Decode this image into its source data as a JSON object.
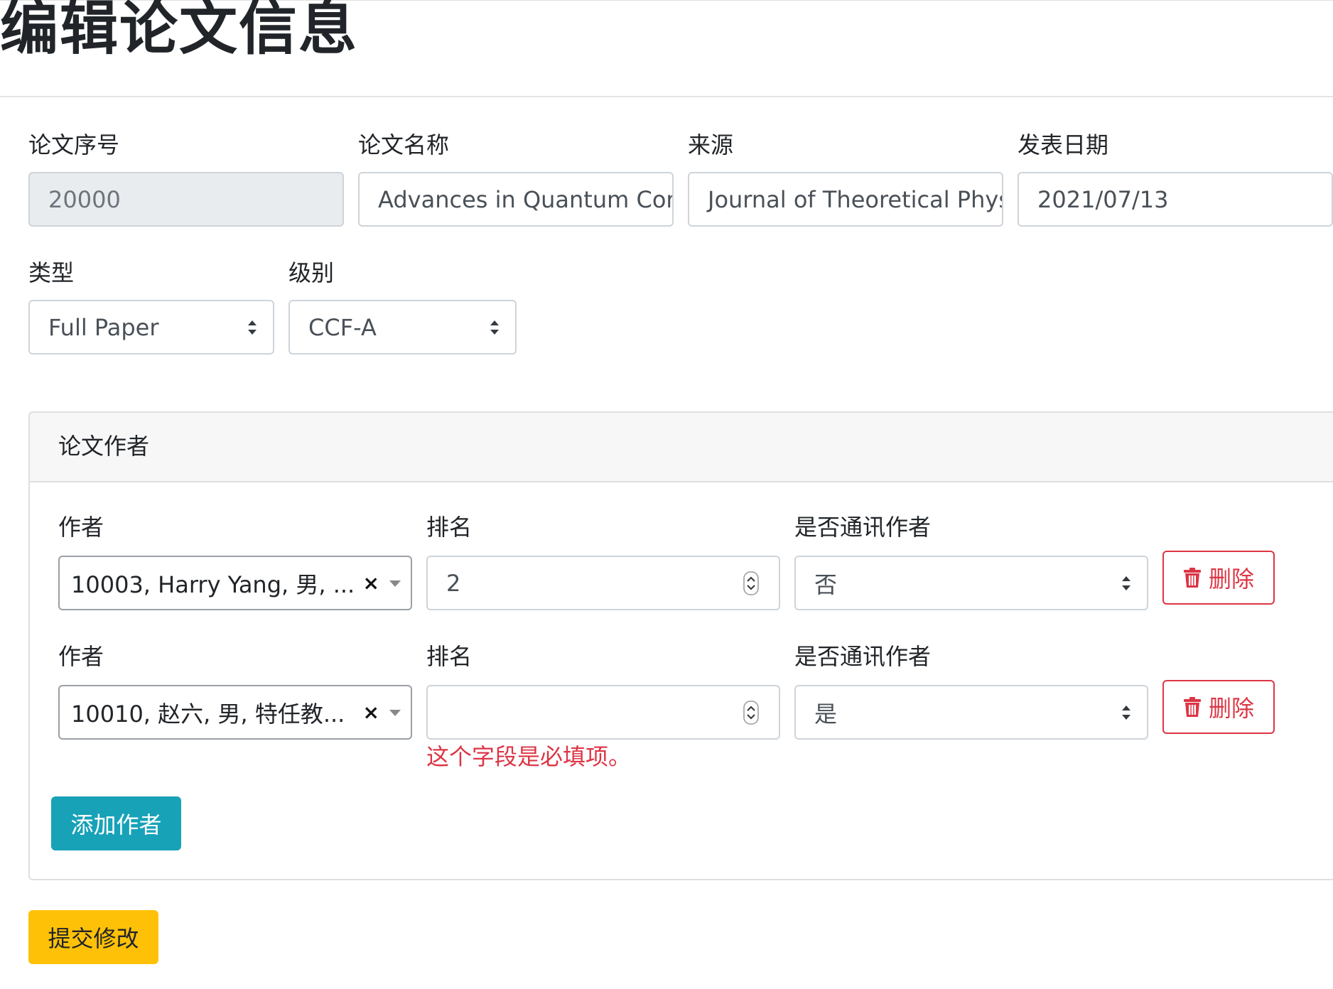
{
  "page": {
    "title": "编辑论文信息"
  },
  "paper": {
    "id_label": "论文序号",
    "id_value": "20000",
    "name_label": "论文名称",
    "name_value": "Advances in Quantum Com",
    "source_label": "来源",
    "source_value": "Journal of Theoretical Phys",
    "date_label": "发表日期",
    "date_value": "2021/07/13",
    "type_label": "类型",
    "type_value": "Full Paper",
    "level_label": "级别",
    "level_value": "CCF-A"
  },
  "authors": {
    "header": "论文作者",
    "rows": [
      {
        "author_label": "作者",
        "author_value": "10003, Harry Yang, 男, ...",
        "rank_label": "排名",
        "rank_value": "2",
        "corr_label": "是否通讯作者",
        "corr_value": "否",
        "delete_label": "删除"
      },
      {
        "author_label": "作者",
        "author_value": "10010, 赵六, 男, 特任教...",
        "rank_label": "排名",
        "rank_value": "",
        "corr_label": "是否通讯作者",
        "corr_value": "是",
        "delete_label": "删除",
        "error": "这个字段是必填项。"
      }
    ],
    "add_button": "添加作者"
  },
  "submit_button": "提交修改",
  "colors": {
    "danger": "#dc3545",
    "info": "#17a2b8",
    "warning": "#ffc107"
  },
  "icons": [
    "trash-icon",
    "select-arrows-icon",
    "spinner-icon",
    "clear-icon",
    "caret-down-icon"
  ]
}
